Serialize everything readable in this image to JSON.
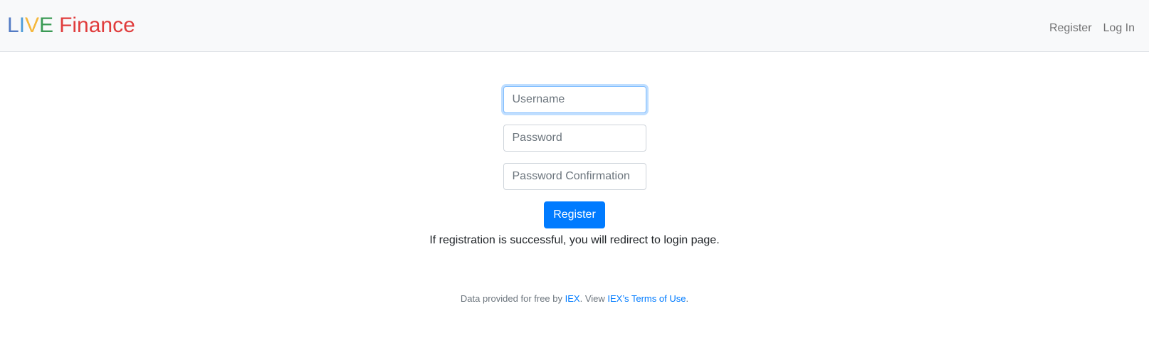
{
  "brand": {
    "letters": [
      {
        "text": "L",
        "color": "#537bc4"
      },
      {
        "text": "I",
        "color": "#4c9bd8"
      },
      {
        "text": "V",
        "color": "#f5b73b"
      },
      {
        "text": "E",
        "color": "#3a9a54"
      }
    ],
    "word": "Finance",
    "word_color": "#e03c3c"
  },
  "nav": {
    "register_label": "Register",
    "login_label": "Log In"
  },
  "form": {
    "username_placeholder": "Username",
    "username_value": "",
    "password_placeholder": "Password",
    "password_value": "",
    "confirmation_placeholder": "Password Confirmation",
    "confirmation_value": "",
    "submit_label": "Register",
    "note": "If registration is successful, you will redirect to login page."
  },
  "footer": {
    "prefix": "Data provided for free by ",
    "iex_link": "IEX",
    "middle": ". View ",
    "terms_link": "IEX’s Terms of Use",
    "suffix": "."
  },
  "colors": {
    "primary": "#007bff",
    "navbar_bg": "#f8f9fa"
  }
}
